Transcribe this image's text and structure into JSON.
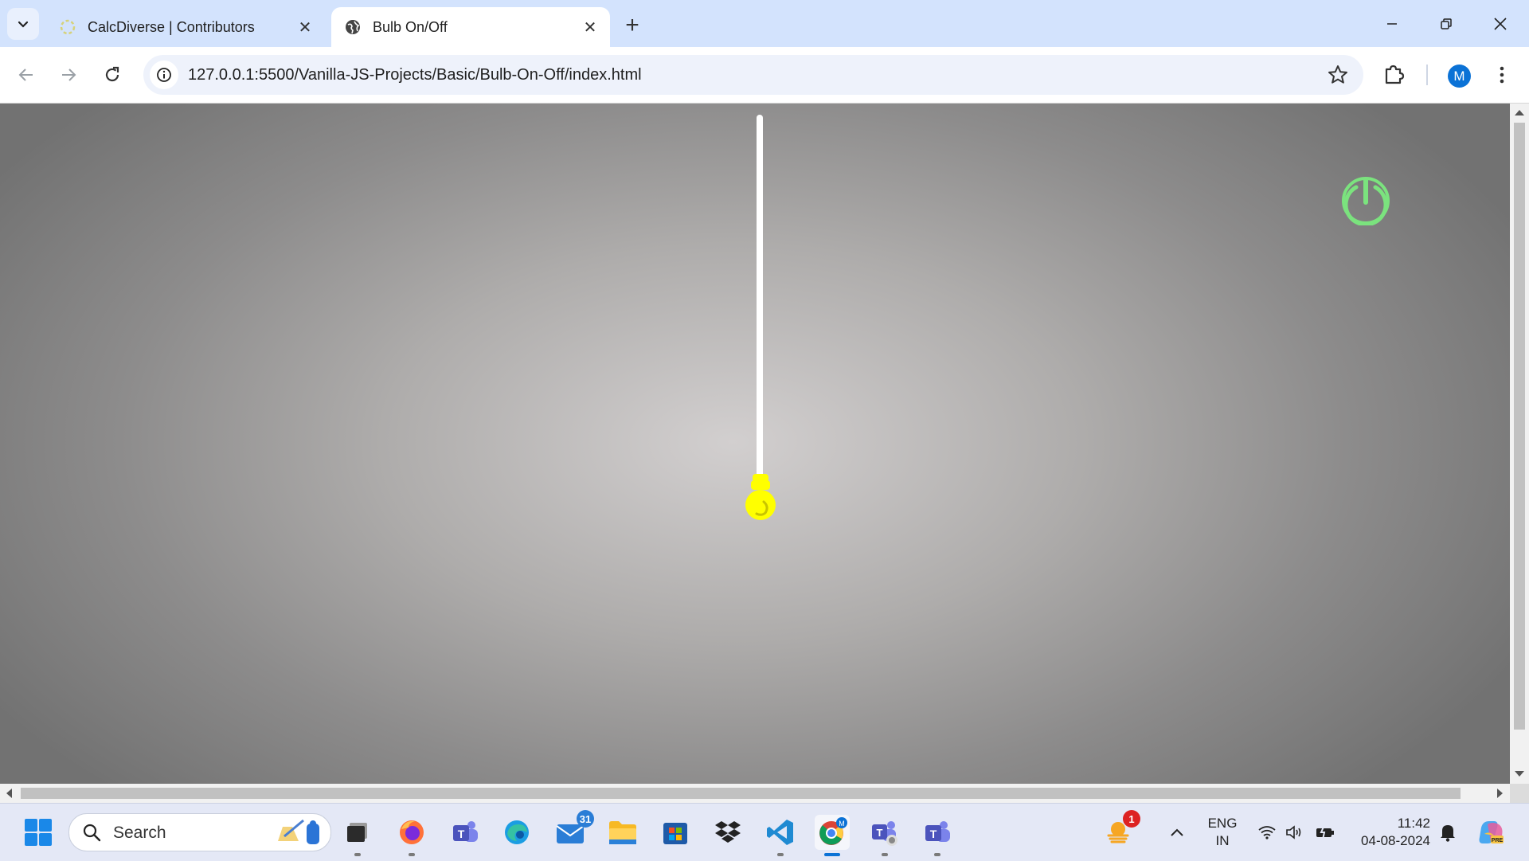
{
  "browser": {
    "tabs": [
      {
        "title": "CalcDiverse | Contributors",
        "active": false,
        "favicon": "calcdiverse-favicon"
      },
      {
        "title": "Bulb On/Off",
        "active": true,
        "favicon": "globe-icon"
      }
    ],
    "address": "127.0.0.1:5500/Vanilla-JS-Projects/Basic/Bulb-On-Off/index.html",
    "profile_initial": "M"
  },
  "page": {
    "bulb_state": "on",
    "colors": {
      "bulb": "#ffff00",
      "cord": "#ffffff",
      "power_button": "#7be37e",
      "background_center": "#d2cfcf",
      "background_edge": "#727272"
    }
  },
  "taskbar": {
    "search_label": "Search",
    "apps": [
      {
        "name": "task-view",
        "running": true
      },
      {
        "name": "firefox",
        "running": true
      },
      {
        "name": "teams",
        "running": false
      },
      {
        "name": "edge",
        "running": false
      },
      {
        "name": "mail",
        "running": false,
        "badge": "31"
      },
      {
        "name": "file-explorer",
        "running": false
      },
      {
        "name": "microsoft-store",
        "running": false
      },
      {
        "name": "dropbox",
        "running": false
      },
      {
        "name": "vscode",
        "running": true
      },
      {
        "name": "chrome",
        "running": true,
        "active": true
      },
      {
        "name": "teams-work",
        "running": true
      },
      {
        "name": "teams-classic",
        "running": true
      }
    ],
    "weather_badge": "1",
    "language": "ENG",
    "region": "IN",
    "time": "11:42",
    "date": "04-08-2024"
  }
}
